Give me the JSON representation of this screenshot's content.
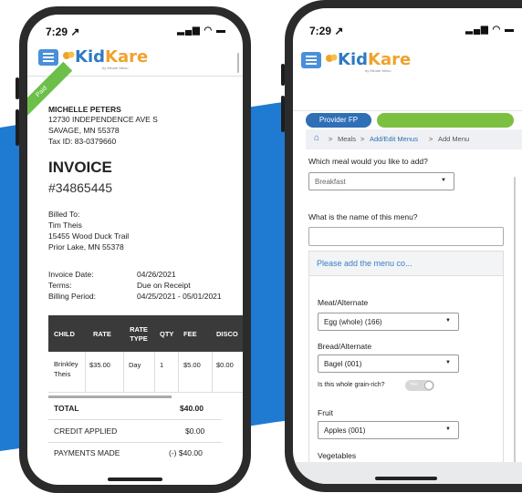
{
  "left_phone": {
    "status_time": "7:29 ↗",
    "status_icons": "▂▄▆ ◠ ▬",
    "brand": {
      "kid": "Kid",
      "kare": "Kare",
      "tagline": "by Minute Menu"
    },
    "paid_label": "Paid",
    "provider": {
      "name": "MICHELLE PETERS",
      "address1": "12730 INDEPENDENCE AVE S",
      "address2": "SAVAGE, MN 55378",
      "tax_id": "Tax ID: 83-0379660"
    },
    "invoice_title": "INVOICE",
    "invoice_number": "#34865445",
    "billed_to": {
      "label": "Billed To:",
      "name": "Tim Theis",
      "address1": "15455 Wood Duck Trail",
      "address2": "Prior Lake, MN 55378"
    },
    "meta": {
      "date_label": "Invoice Date:",
      "date_value": "04/26/2021",
      "terms_label": "Terms:",
      "terms_value": "Due on Receipt",
      "period_label": "Billing Period:",
      "period_value": "04/25/2021 - 05/01/2021"
    },
    "table": {
      "headers": [
        "CHILD",
        "RATE",
        "RATE TYPE",
        "QTY",
        "FEE",
        "DISCO"
      ],
      "row": [
        "Brinkley Theis",
        "$35.00",
        "Day",
        "1",
        "$5.00",
        "$0.00"
      ]
    },
    "totals": {
      "total_label": "TOTAL",
      "total_value": "$40.00",
      "credit_label": "CREDIT APPLIED",
      "credit_value": "$0.00",
      "payments_label": "PAYMENTS MADE",
      "payments_value": "(-) $40.00"
    }
  },
  "right_phone": {
    "status_time": "7:29 ↗",
    "status_icons": "▂▄▆ ◠ ▬",
    "brand": {
      "kid": "Kid",
      "kare": "Kare",
      "tagline": "by Minute Menu"
    },
    "provider_button": "Provider FP",
    "breadcrumbs": {
      "meals": "Meals",
      "add_edit": "Add/Edit Menus",
      "current": "Add Menu",
      "sep": ">"
    },
    "meal_question": "Which meal would you like to add?",
    "meal_value": "Breakfast",
    "name_question": "What is the name of this menu?",
    "name_value": "",
    "card_header": "Please add the menu co...",
    "meat": {
      "label": "Meat/Alternate",
      "value": "Egg (whole) (166)"
    },
    "bread": {
      "label": "Bread/Alternate",
      "value": "Bagel (001)"
    },
    "grain_question": "Is this whole grain-rich?",
    "grain_toggle": "Yes",
    "fruit": {
      "label": "Fruit",
      "value": "Apples (001)"
    },
    "vegetables_label": "Vegetables"
  },
  "colors": {
    "brand_blue": "#2e79c4",
    "brand_orange": "#f0a22c",
    "paid_green": "#6cc04a",
    "provider_blue": "#2e6fb6",
    "accent_green": "#7cc042",
    "wave_blue": "#1f7bd1"
  }
}
